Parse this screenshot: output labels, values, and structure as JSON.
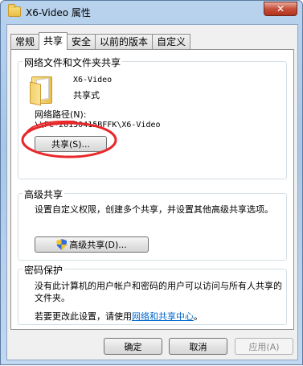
{
  "window": {
    "title": "X6-Video 属性",
    "close_glyph": "✕"
  },
  "tabs": [
    {
      "label": "常规",
      "active": false
    },
    {
      "label": "共享",
      "active": true
    },
    {
      "label": "安全",
      "active": false
    },
    {
      "label": "以前的版本",
      "active": false
    },
    {
      "label": "自定义",
      "active": false
    }
  ],
  "network_sharing": {
    "group_title": "网络文件和文件夹共享",
    "folder_name": "X6-Video",
    "folder_status": "共享式",
    "path_label": "网络路径(N):",
    "path_value": "\\\\PC-20150415BFFK\\X6-Video",
    "share_button": "共享(S)..."
  },
  "advanced_sharing": {
    "group_title": "高级共享",
    "description": "设置自定义权限，创建多个共享，并设置其他高级共享选项。",
    "button": "高级共享(D)..."
  },
  "password_protection": {
    "group_title": "密码保护",
    "description": "没有此计算机的用户帐户和密码的用户可以访问与所有人共享的文件夹。",
    "change_prefix": "若要更改此设置，请使用",
    "link": "网络和共享中心",
    "suffix": "。"
  },
  "footer": {
    "ok": "确定",
    "cancel": "取消",
    "apply": "应用(A)"
  },
  "icons": {
    "folder": "folder-icon",
    "shield": "shield-icon",
    "close": "close-icon"
  },
  "colors": {
    "annotation_ring": "#e8282b",
    "link": "#0066cc"
  }
}
